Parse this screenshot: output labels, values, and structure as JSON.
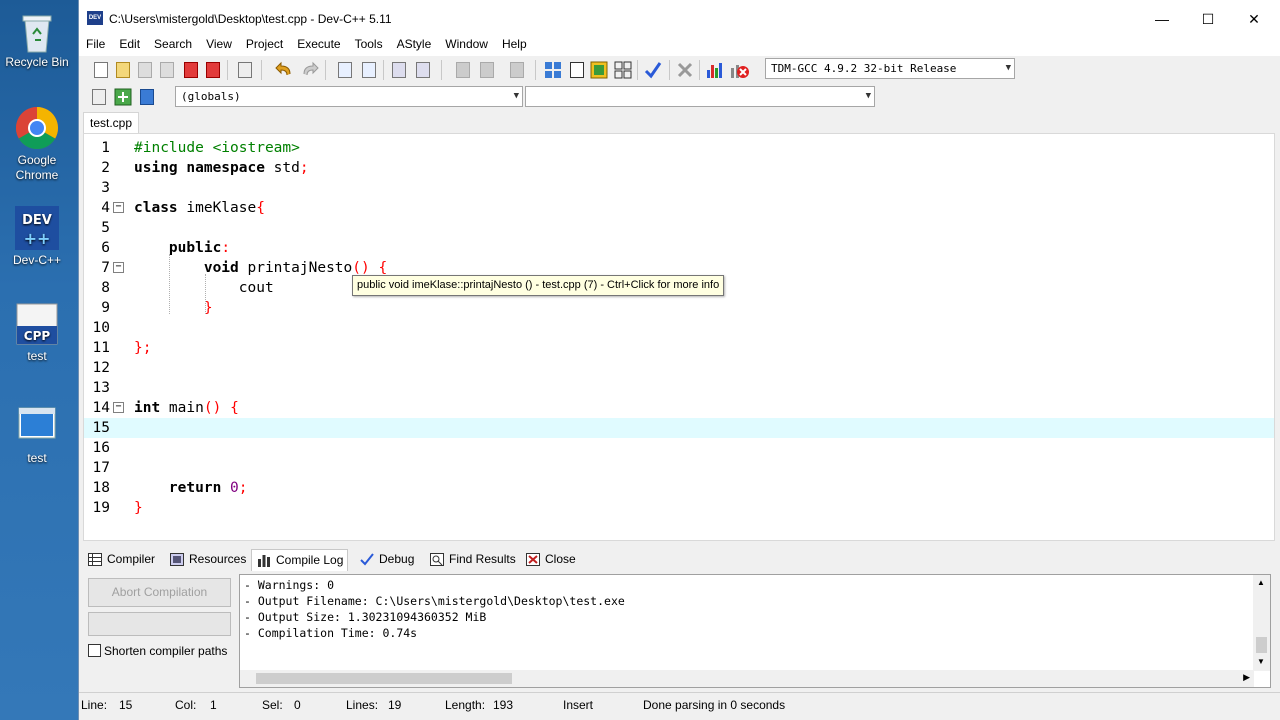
{
  "desktop": {
    "icons": [
      {
        "label": "Recycle Bin"
      },
      {
        "label": "Google Chrome"
      },
      {
        "label": "Dev-C++"
      },
      {
        "label": "test",
        "badge": "CPP"
      },
      {
        "label": "test"
      }
    ]
  },
  "window": {
    "title": "C:\\Users\\mistergold\\Desktop\\test.cpp - Dev-C++ 5.11",
    "app_icon_text": "DEV",
    "controls": {
      "minimize": "—",
      "maximize": "☐",
      "close": "✕"
    }
  },
  "menu": [
    "File",
    "Edit",
    "Search",
    "View",
    "Project",
    "Execute",
    "Tools",
    "AStyle",
    "Window",
    "Help"
  ],
  "toolbar": {
    "compiler_select": "TDM-GCC 4.9.2 32-bit Release",
    "scope_select": "(globals)",
    "member_select": ""
  },
  "editor": {
    "tab": "test.cpp",
    "lines": [
      {
        "n": "1",
        "html": "<span class=\"pp\">#include &lt;iostream&gt;</span>"
      },
      {
        "n": "2",
        "html": "<span class=\"kw\">using namespace</span> std<span class=\"sym\">;</span>"
      },
      {
        "n": "3",
        "html": ""
      },
      {
        "n": "4",
        "html": "<span class=\"kw\">class</span> imeKlase<span class=\"sym\">{</span>",
        "fold": "⊟"
      },
      {
        "n": "5",
        "html": ""
      },
      {
        "n": "6",
        "html": "    <span class=\"kw\">public</span><span class=\"sym\">:</span>"
      },
      {
        "n": "7",
        "html": "        <span class=\"kw\">void</span> printajNesto<span class=\"sym\">()</span> <span class=\"sym\">{</span>",
        "fold": "⊟"
      },
      {
        "n": "8",
        "html": "            cout"
      },
      {
        "n": "9",
        "html": "        <span class=\"sym\">}</span>"
      },
      {
        "n": "10",
        "html": ""
      },
      {
        "n": "11",
        "html": "<span class=\"sym\">};</span>"
      },
      {
        "n": "12",
        "html": ""
      },
      {
        "n": "13",
        "html": ""
      },
      {
        "n": "14",
        "html": "<span class=\"kw\">int</span> main<span class=\"sym\">()</span> <span class=\"sym\">{</span>",
        "fold": "⊟"
      },
      {
        "n": "15",
        "html": "",
        "current": true
      },
      {
        "n": "16",
        "html": ""
      },
      {
        "n": "17",
        "html": ""
      },
      {
        "n": "18",
        "html": "    <span class=\"kw\">return</span> <span class=\"num\">0</span><span class=\"sym\">;</span>"
      },
      {
        "n": "19",
        "html": "<span class=\"sym\">}</span>"
      }
    ],
    "tooltip": "public void imeKlase::printajNesto () - test.cpp (7) - Ctrl+Click for more info"
  },
  "bottom_tabs": [
    "Compiler",
    "Resources",
    "Compile Log",
    "Debug",
    "Find Results",
    "Close"
  ],
  "bottom_active_tab": "Compile Log",
  "abort_label": "Abort Compilation",
  "shorten_label": "Shorten compiler paths",
  "log_lines": [
    "- Warnings: 0",
    "- Output Filename: C:\\Users\\mistergold\\Desktop\\test.exe",
    "- Output Size: 1.30231094360352 MiB",
    "- Compilation Time: 0.74s"
  ],
  "status": {
    "line_label": "Line:",
    "line_value": "15",
    "col_label": "Col:",
    "col_value": "1",
    "sel_label": "Sel:",
    "sel_value": "0",
    "lines_label": "Lines:",
    "lines_value": "19",
    "length_label": "Length:",
    "length_value": "193",
    "mode": "Insert",
    "message": "Done parsing in 0 seconds"
  },
  "colors": {
    "current_line": "#e0fbff",
    "keyword": "#000000",
    "symbol": "#ff0000",
    "preprocessor": "#008000",
    "number": "#800080"
  }
}
